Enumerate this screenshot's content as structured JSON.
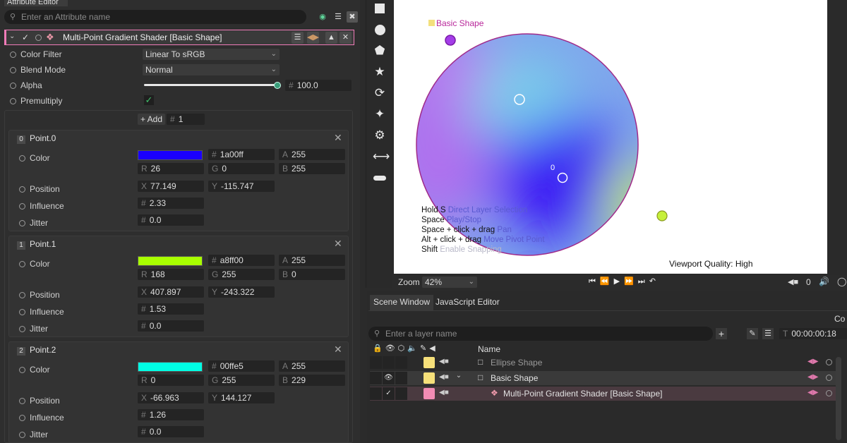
{
  "attribute_editor": {
    "panel_title": "Attribute Editor",
    "search_placeholder": "Enter an Attribute name",
    "shader_title": "Multi-Point Gradient Shader [Basic Shape]",
    "color_filter": {
      "label": "Color Filter",
      "value": "Linear To sRGB"
    },
    "blend_mode": {
      "label": "Blend Mode",
      "value": "Normal"
    },
    "alpha": {
      "label": "Alpha",
      "value": "100.0",
      "prefix": "#",
      "level": 1.0
    },
    "premultiply": {
      "label": "Premultiply",
      "checked": true
    },
    "add_label": "+ Add",
    "add_count_prefix": "#",
    "add_count": "1",
    "labels": {
      "color": "Color",
      "position": "Position",
      "influence": "Influence",
      "jitter": "Jitter"
    },
    "points": [
      {
        "index": "0",
        "name": "Point.0",
        "swatch": "#1a00ff",
        "hex": "1a00ff",
        "a": "255",
        "r": "26",
        "g": "0",
        "b": "255",
        "x": "77.149",
        "y": "-115.747",
        "influence": "2.33",
        "jitter": "0.0"
      },
      {
        "index": "1",
        "name": "Point.1",
        "swatch": "#a8ff00",
        "hex": "a8ff00",
        "a": "255",
        "r": "168",
        "g": "255",
        "b": "0",
        "x": "407.897",
        "y": "-243.322",
        "influence": "1.53",
        "jitter": "0.0"
      },
      {
        "index": "2",
        "name": "Point.2",
        "swatch": "#00ffe5",
        "hex": "00ffe5",
        "a": "255",
        "r": "0",
        "g": "255",
        "b": "229",
        "x": "-66.963",
        "y": "144.127",
        "influence": "1.26",
        "jitter": "0.0"
      }
    ]
  },
  "viewport": {
    "shape_label": "Basic Shape",
    "point_label": "0",
    "shortcuts": [
      {
        "key": "Hold S",
        "hint": "Direct Layer Selection",
        "style": "hint"
      },
      {
        "key": "Space",
        "hint": "Play/Stop",
        "style": "hint"
      },
      {
        "key": "Space + click + drag",
        "hint": "Pan",
        "style": "hint"
      },
      {
        "key": "Alt + click + drag",
        "hint": "Move Pivot Point",
        "style": "hint"
      },
      {
        "key": "Shift",
        "hint": "Enable Snapping",
        "style": "hint-faded"
      }
    ],
    "quality": "Viewport Quality: High",
    "zoom_label": "Zoom",
    "zoom_value": "42%",
    "frame_value": "0"
  },
  "scene_window": {
    "tabs": [
      "Scene Window",
      "JavaScript Editor"
    ],
    "right_cut_label": "Co",
    "search_placeholder": "Enter a layer name",
    "time_prefix": "T",
    "time": "00:00:00:18",
    "name_header": "Name",
    "layers": [
      {
        "name": "Ellipse Shape",
        "swatch": "#f6e07a",
        "dim": true
      },
      {
        "name": "Basic Shape",
        "swatch": "#f6e07a",
        "dim": false
      },
      {
        "name": "Multi-Point Gradient Shader [Basic Shape]",
        "swatch": "#f28cb4",
        "dim": false
      }
    ]
  },
  "colors": {
    "accent_pink": "#f07bb8",
    "shape_stroke": "#a02a8a",
    "handle_purple": "#a43ee8",
    "handle_green": "#c6f03a"
  }
}
